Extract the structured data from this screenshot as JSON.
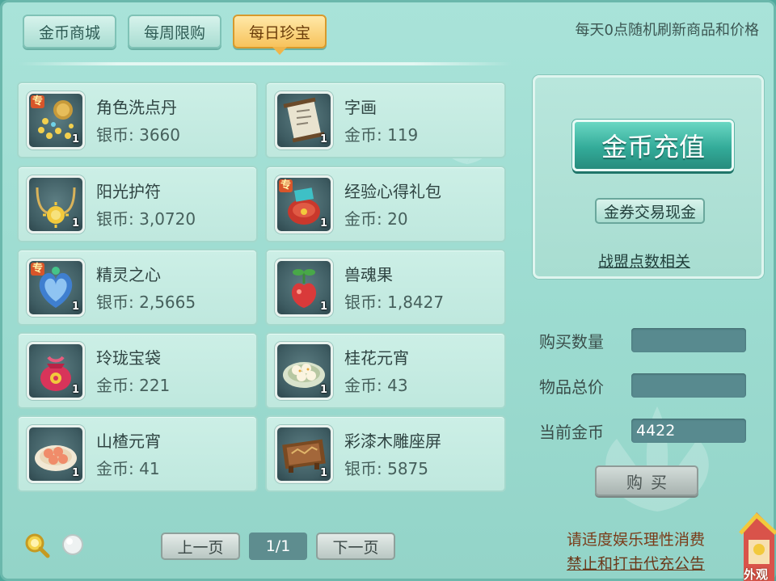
{
  "tabs": [
    {
      "label": "金币商城",
      "active": false
    },
    {
      "label": "每周限购",
      "active": false
    },
    {
      "label": "每日珍宝",
      "active": true
    }
  ],
  "refresh_notice": "每天0点随机刷新商品和价格",
  "items": [
    {
      "name": "角色洗点丹",
      "currency": "银币",
      "price": "3660",
      "quantity": "1",
      "exclusive": true,
      "icon": "gold-pellets-icon"
    },
    {
      "name": "字画",
      "currency": "金币",
      "price": "119",
      "quantity": "1",
      "exclusive": false,
      "icon": "scroll-painting-icon"
    },
    {
      "name": "阳光护符",
      "currency": "银币",
      "price": "3,0720",
      "quantity": "1",
      "exclusive": false,
      "icon": "sun-amulet-icon"
    },
    {
      "name": "经验心得礼包",
      "currency": "金币",
      "price": "20",
      "quantity": "1",
      "exclusive": true,
      "icon": "gift-bag-icon"
    },
    {
      "name": "精灵之心",
      "currency": "银币",
      "price": "2,5665",
      "quantity": "1",
      "exclusive": true,
      "icon": "spirit-heart-icon"
    },
    {
      "name": "兽魂果",
      "currency": "银币",
      "price": "1,8427",
      "quantity": "1",
      "exclusive": false,
      "icon": "beast-fruit-icon"
    },
    {
      "name": "玲珑宝袋",
      "currency": "金币",
      "price": "221",
      "quantity": "1",
      "exclusive": false,
      "icon": "treasure-pouch-icon"
    },
    {
      "name": "桂花元宵",
      "currency": "金币",
      "price": "43",
      "quantity": "1",
      "exclusive": false,
      "icon": "osmanthus-dumplings-icon"
    },
    {
      "name": "山楂元宵",
      "currency": "金币",
      "price": "41",
      "quantity": "1",
      "exclusive": false,
      "icon": "hawthorn-dumplings-icon"
    },
    {
      "name": "彩漆木雕座屏",
      "currency": "银币",
      "price": "5875",
      "quantity": "1",
      "exclusive": false,
      "icon": "carved-screen-icon"
    }
  ],
  "exclusive_badge": "专",
  "recharge_label": "金币充值",
  "trade_label": "金券交易现金",
  "alliance_label": "战盟点数相关",
  "form": {
    "quantity_label": "购买数量",
    "quantity_value": "",
    "total_label": "物品总价",
    "total_value": "",
    "gold_label": "当前金币",
    "gold_value": "4422"
  },
  "buy_label": "购买",
  "pagination": {
    "prev_label": "上一页",
    "indicator": "1/1",
    "next_label": "下一页"
  },
  "bottom_notice": {
    "line1": "请适度娱乐理性消费",
    "line2": "禁止和打击代充公告"
  },
  "mascot_text": "外观",
  "colors": {
    "panel": "#9ddcd1",
    "active_tab": "#f7c35c",
    "recharge": "#33ab99",
    "notice": "#7a3c1a"
  }
}
